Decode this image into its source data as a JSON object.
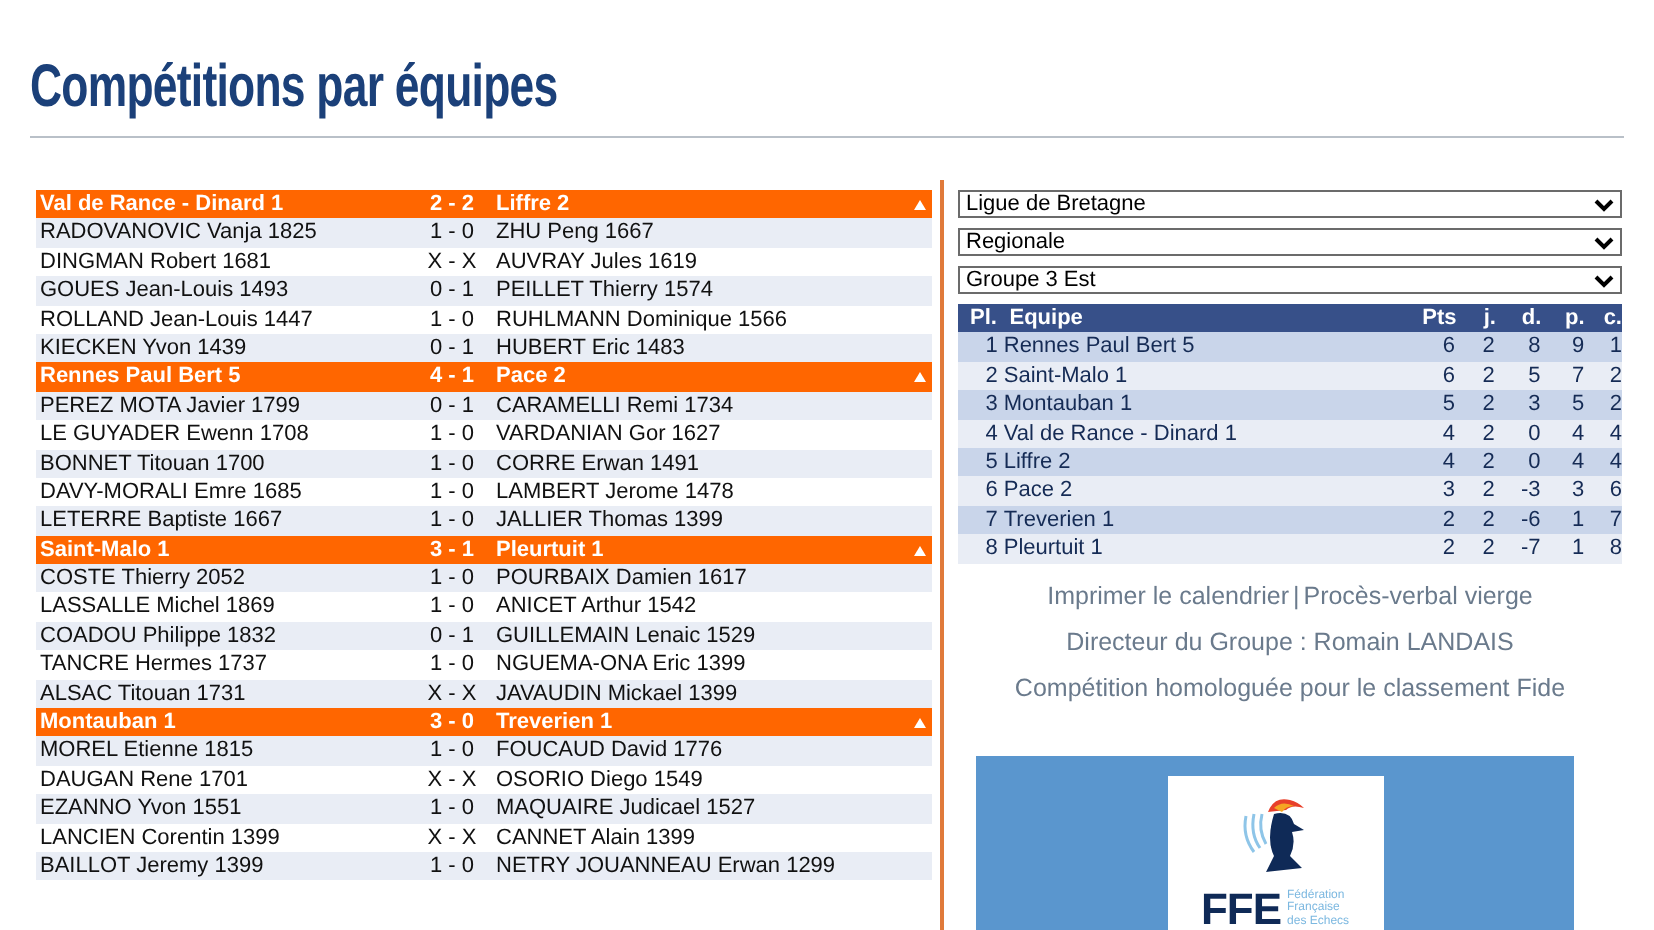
{
  "page": {
    "title": "Compétitions par équipes"
  },
  "matches": [
    {
      "home": "Val de Rance - Dinard 1",
      "score": "2 - 2",
      "away": "Liffre 2",
      "boards": [
        {
          "white": "RADOVANOVIC Vanja 1825",
          "result": "1 - 0",
          "black": "ZHU Peng 1667"
        },
        {
          "white": "DINGMAN Robert 1681",
          "result": "X - X",
          "black": "AUVRAY Jules 1619"
        },
        {
          "white": "GOUES Jean-Louis 1493",
          "result": "0 - 1",
          "black": "PEILLET Thierry 1574"
        },
        {
          "white": "ROLLAND Jean-Louis 1447",
          "result": "1 - 0",
          "black": "RUHLMANN Dominique 1566"
        },
        {
          "white": "KIECKEN Yvon 1439",
          "result": "0 - 1",
          "black": "HUBERT Eric 1483"
        }
      ]
    },
    {
      "home": "Rennes Paul Bert 5",
      "score": "4 - 1",
      "away": "Pace 2",
      "boards": [
        {
          "white": "PEREZ MOTA Javier 1799",
          "result": "0 - 1",
          "black": "CARAMELLI Remi 1734"
        },
        {
          "white": "LE GUYADER Ewenn 1708",
          "result": "1 - 0",
          "black": "VARDANIAN Gor 1627"
        },
        {
          "white": "BONNET Titouan 1700",
          "result": "1 - 0",
          "black": "CORRE Erwan 1491"
        },
        {
          "white": "DAVY-MORALI Emre 1685",
          "result": "1 - 0",
          "black": "LAMBERT Jerome 1478"
        },
        {
          "white": "LETERRE Baptiste 1667",
          "result": "1 - 0",
          "black": "JALLIER Thomas 1399"
        }
      ]
    },
    {
      "home": "Saint-Malo 1",
      "score": "3 - 1",
      "away": "Pleurtuit 1",
      "boards": [
        {
          "white": "COSTE Thierry 2052",
          "result": "1 - 0",
          "black": "POURBAIX Damien 1617"
        },
        {
          "white": "LASSALLE Michel 1869",
          "result": "1 - 0",
          "black": "ANICET Arthur 1542"
        },
        {
          "white": "COADOU Philippe 1832",
          "result": "0 - 1",
          "black": "GUILLEMAIN Lenaic 1529"
        },
        {
          "white": "TANCRE Hermes 1737",
          "result": "1 - 0",
          "black": "NGUEMA-ONA Eric 1399"
        },
        {
          "white": "ALSAC Titouan 1731",
          "result": "X - X",
          "black": "JAVAUDIN Mickael 1399"
        }
      ]
    },
    {
      "home": "Montauban 1",
      "score": "3 - 0",
      "away": "Treverien 1",
      "boards": [
        {
          "white": "MOREL Etienne 1815",
          "result": "1 - 0",
          "black": "FOUCAUD David 1776"
        },
        {
          "white": "DAUGAN Rene 1701",
          "result": "X - X",
          "black": "OSORIO Diego 1549"
        },
        {
          "white": "EZANNO Yvon 1551",
          "result": "1 - 0",
          "black": "MAQUAIRE Judicael 1527"
        },
        {
          "white": "LANCIEN Corentin 1399",
          "result": "X - X",
          "black": "CANNET Alain 1399"
        },
        {
          "white": "BAILLOT Jeremy 1399",
          "result": "1 - 0",
          "black": "NETRY JOUANNEAU Erwan 1299"
        }
      ]
    }
  ],
  "filters": [
    {
      "value": "Ligue de Bretagne"
    },
    {
      "value": "Regionale"
    },
    {
      "value": "Groupe 3 Est"
    }
  ],
  "standings": {
    "columns": [
      "Pl.",
      "Equipe",
      "Pts",
      "j.",
      "d.",
      "p.",
      "c."
    ],
    "rows": [
      {
        "rank": "1",
        "team": "Rennes Paul Bert 5",
        "pts": "6",
        "j": "2",
        "d": "8",
        "p": "9",
        "c": "1"
      },
      {
        "rank": "2",
        "team": "Saint-Malo 1",
        "pts": "6",
        "j": "2",
        "d": "5",
        "p": "7",
        "c": "2"
      },
      {
        "rank": "3",
        "team": "Montauban 1",
        "pts": "5",
        "j": "2",
        "d": "3",
        "p": "5",
        "c": "2"
      },
      {
        "rank": "4",
        "team": "Val de Rance - Dinard 1",
        "pts": "4",
        "j": "2",
        "d": "0",
        "p": "4",
        "c": "4"
      },
      {
        "rank": "5",
        "team": "Liffre 2",
        "pts": "4",
        "j": "2",
        "d": "0",
        "p": "4",
        "c": "4"
      },
      {
        "rank": "6",
        "team": "Pace 2",
        "pts": "3",
        "j": "2",
        "d": "-3",
        "p": "3",
        "c": "6"
      },
      {
        "rank": "7",
        "team": "Treverien 1",
        "pts": "2",
        "j": "2",
        "d": "-6",
        "p": "1",
        "c": "7"
      },
      {
        "rank": "8",
        "team": "Pleurtuit 1",
        "pts": "2",
        "j": "2",
        "d": "-7",
        "p": "1",
        "c": "8"
      }
    ]
  },
  "links": [
    {
      "label": "Imprimer le calendrier"
    },
    {
      "label": "Procès-verbal vierge"
    }
  ],
  "separator": "|",
  "director": "Directeur du Groupe : Romain LANDAIS",
  "note": "Compétition homologuée pour le classement Fide",
  "logo": {
    "acronym": "FFE",
    "name_lines": [
      "Fédération",
      "Française",
      "des Echecs"
    ]
  }
}
